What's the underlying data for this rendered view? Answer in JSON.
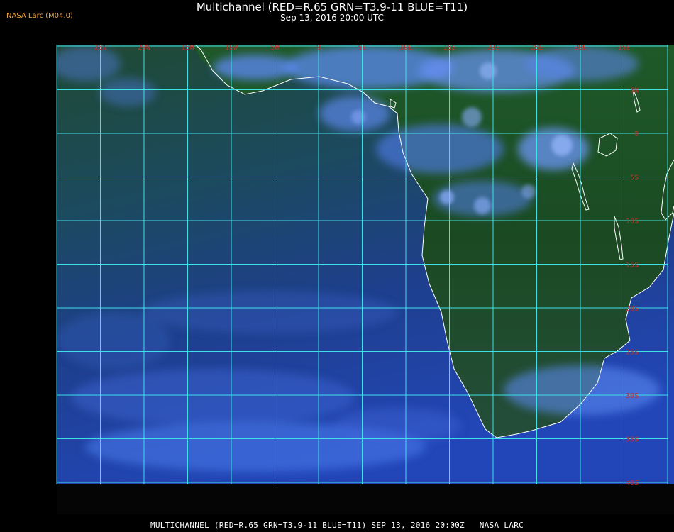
{
  "header": {
    "title": "Multichannel (RED=R.65 GRN=T3.9-11 BLUE=T11)",
    "subtitle": "Sep 13, 2016 20:00 UTC",
    "credit": "NASA Larc (M04.0)"
  },
  "footer": {
    "caption": "MULTICHANNEL (RED=R.65 GRN=T3.9-11 BLUE=T11) SEP 13, 2016 20:00Z   NASA LARC"
  },
  "map": {
    "longitude_labels": [
      "25W",
      "20W",
      "15W",
      "10W",
      "5W",
      "0",
      "5E",
      "10E",
      "15E",
      "20E",
      "25E",
      "30E",
      "35E"
    ],
    "latitude_labels": [
      "5N",
      "0",
      "5S",
      "10S",
      "15S",
      "20S",
      "25S",
      "30S",
      "35S",
      "40S"
    ],
    "colors": {
      "grid": "#3fe0e6",
      "label": "#c0302a",
      "coast": "#ffffff",
      "ocean": "#1a3f8a",
      "land": "#1d4a20",
      "cloud": "#5a88f0"
    }
  }
}
